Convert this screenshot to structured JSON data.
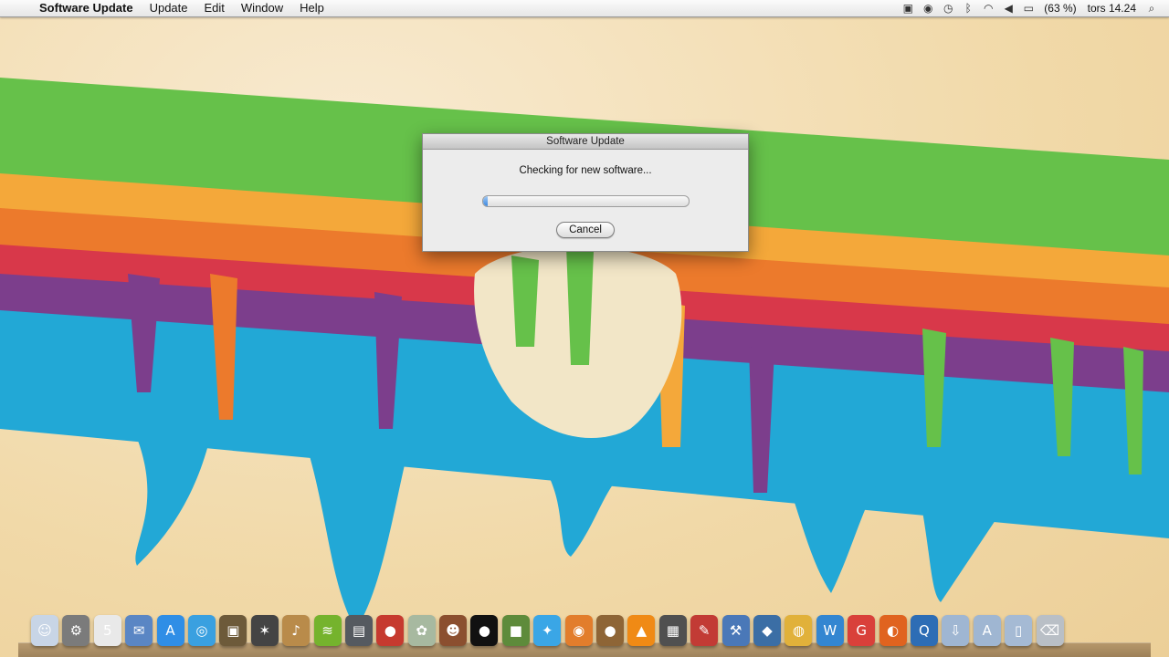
{
  "menubar": {
    "apple_glyph": "",
    "app_name": "Software Update",
    "menus": [
      "Update",
      "Edit",
      "Window",
      "Help"
    ],
    "status_icons": [
      "screen-record-icon",
      "eye-icon",
      "time-machine-icon",
      "bluetooth-icon",
      "wifi-icon",
      "volume-icon",
      "battery-icon"
    ],
    "battery_text": "(63 %)",
    "clock": "tors 14.24",
    "search_icon": "spotlight-search-icon"
  },
  "dialog": {
    "title": "Software Update",
    "message": "Checking for new software...",
    "progress_fraction": 0.02,
    "cancel_label": "Cancel"
  },
  "dock": {
    "icons": [
      {
        "name": "finder-icon",
        "color": "#c8d5e6",
        "glyph": "☺"
      },
      {
        "name": "system-preferences-icon",
        "color": "#7b7b7b",
        "glyph": "⚙"
      },
      {
        "name": "calendar-icon",
        "color": "#e9e9e9",
        "glyph": "5"
      },
      {
        "name": "mail-icon",
        "color": "#5a86c4",
        "glyph": "✉"
      },
      {
        "name": "app-store-icon",
        "color": "#2f8ee6",
        "glyph": "A"
      },
      {
        "name": "safari-icon",
        "color": "#3aa0e0",
        "glyph": "◎"
      },
      {
        "name": "preview-icon",
        "color": "#6d5a3a",
        "glyph": "▣"
      },
      {
        "name": "garage-tool-icon",
        "color": "#444444",
        "glyph": "✶"
      },
      {
        "name": "guitar-icon",
        "color": "#b98b4a",
        "glyph": "♪"
      },
      {
        "name": "spotify-icon",
        "color": "#75b32d",
        "glyph": "≋"
      },
      {
        "name": "steam-icon",
        "color": "#555a60",
        "glyph": "▤"
      },
      {
        "name": "angry-birds-icon",
        "color": "#c63a2f",
        "glyph": "●"
      },
      {
        "name": "app-icon-plants",
        "color": "#a7b9a0",
        "glyph": "✿"
      },
      {
        "name": "game-character-icon",
        "color": "#8b4f2f",
        "glyph": "☻"
      },
      {
        "name": "black-app-icon",
        "color": "#111111",
        "glyph": "●"
      },
      {
        "name": "minecraft-icon",
        "color": "#5e8b3b",
        "glyph": "■"
      },
      {
        "name": "twitter-icon",
        "color": "#3aa6e6",
        "glyph": "✦"
      },
      {
        "name": "photo-app-icon",
        "color": "#e27d2c",
        "glyph": "◉"
      },
      {
        "name": "acorn-icon",
        "color": "#8e6536",
        "glyph": "●"
      },
      {
        "name": "vlc-icon",
        "color": "#f08a15",
        "glyph": "▲"
      },
      {
        "name": "movie-icon",
        "color": "#505050",
        "glyph": "▦"
      },
      {
        "name": "script-icon",
        "color": "#c23b35",
        "glyph": "✎"
      },
      {
        "name": "xcode-icon",
        "color": "#4a78b8",
        "glyph": "⚒"
      },
      {
        "name": "python-icon",
        "color": "#3b6ea5",
        "glyph": "◆"
      },
      {
        "name": "network-icon",
        "color": "#e1b13a",
        "glyph": "◍"
      },
      {
        "name": "word-icon",
        "color": "#3386d1",
        "glyph": "W"
      },
      {
        "name": "chrome-app-icon",
        "color": "#d9403a",
        "glyph": "G"
      },
      {
        "name": "firefox-icon",
        "color": "#e0631f",
        "glyph": "◐"
      },
      {
        "name": "quicktime-icon",
        "color": "#2d6db5",
        "glyph": "Q"
      },
      {
        "name": "downloads-folder-icon",
        "color": "#9fb6d2",
        "glyph": "⇩"
      },
      {
        "name": "applications-folder-icon",
        "color": "#9fb6d2",
        "glyph": "A"
      },
      {
        "name": "documents-folder-icon",
        "color": "#a5bad4",
        "glyph": "▯"
      },
      {
        "name": "trash-icon",
        "color": "#b9bfc6",
        "glyph": "⌫"
      }
    ]
  }
}
